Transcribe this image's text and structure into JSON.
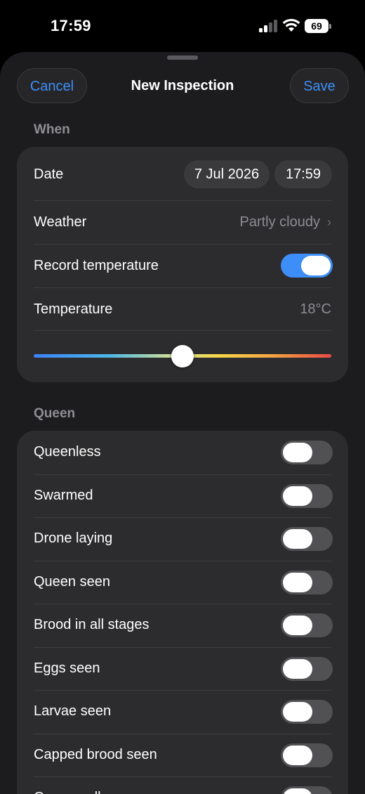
{
  "status_bar": {
    "time": "17:59",
    "battery": "69",
    "icons": [
      "cellular-signal-icon",
      "wifi-icon",
      "battery-icon"
    ]
  },
  "nav": {
    "cancel_label": "Cancel",
    "title": "New Inspection",
    "save_label": "Save"
  },
  "accent_color": "#3d8ef7",
  "when": {
    "header": "When",
    "date_label": "Date",
    "date_value": "7 Jul 2026",
    "time_value": "17:59",
    "weather_label": "Weather",
    "weather_value": "Partly cloudy",
    "record_temperature_label": "Record temperature",
    "record_temperature_on": true,
    "temperature_label": "Temperature",
    "temperature_value": "18°C",
    "temperature_slider_fraction": 0.5
  },
  "queen": {
    "header": "Queen",
    "items": [
      {
        "label": "Queenless",
        "on": false
      },
      {
        "label": "Swarmed",
        "on": false
      },
      {
        "label": "Drone laying",
        "on": false
      },
      {
        "label": "Queen seen",
        "on": false
      },
      {
        "label": "Brood in all stages",
        "on": false
      },
      {
        "label": "Eggs seen",
        "on": false
      },
      {
        "label": "Larvae seen",
        "on": false
      },
      {
        "label": "Capped brood seen",
        "on": false
      },
      {
        "label": "Queen cells",
        "on": false
      }
    ]
  }
}
